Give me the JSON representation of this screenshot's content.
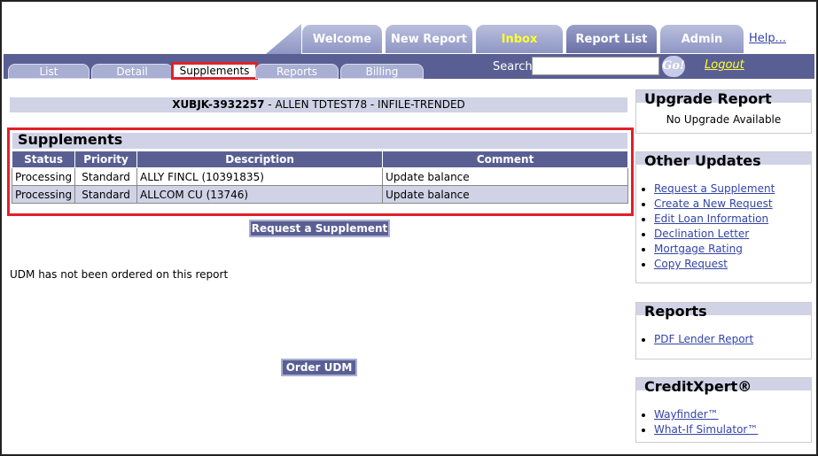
{
  "top_tabs": {
    "welcome": "Welcome",
    "new_report": "New Report",
    "inbox": "Inbox",
    "report_list": "Report List",
    "admin": "Admin",
    "help": "Help..."
  },
  "sub_tabs": {
    "list": "List",
    "detail": "Detail",
    "supplements": "Supplements",
    "reports": "Reports",
    "billing": "Billing"
  },
  "search": {
    "label": "Search:",
    "value": "",
    "go_label": "Go!"
  },
  "logout": "Logout",
  "report_header": {
    "id": "XUBJK-3932257",
    "rest": " - ALLEN TDTEST78 - INFILE-TRENDED"
  },
  "supplements": {
    "title": "Supplements",
    "columns": {
      "status": "Status",
      "priority": "Priority",
      "description": "Description",
      "comment": "Comment"
    },
    "rows": [
      {
        "status": "Processing",
        "priority": "Standard",
        "description": "ALLY FINCL (10391835)",
        "comment": "Update balance"
      },
      {
        "status": "Processing",
        "priority": "Standard",
        "description": "ALLCOM CU (13746)",
        "comment": "Update balance"
      }
    ],
    "request_button": "Request a Supplement"
  },
  "udm": {
    "message": "UDM has not been ordered on this report",
    "order_button": "Order UDM"
  },
  "sidebar": {
    "upgrade": {
      "title": "Upgrade Report",
      "text": "No Upgrade Available"
    },
    "other_updates": {
      "title": "Other Updates",
      "items": [
        "Request a Supplement",
        "Create a New Request",
        "Edit Loan Information",
        "Declination Letter",
        "Mortgage Rating",
        "Copy Request"
      ]
    },
    "reports": {
      "title": "Reports",
      "items": [
        "PDF Lender Report"
      ]
    },
    "creditxpert": {
      "title": "CreditXpert®",
      "items": [
        "Wayfinder™",
        "What-If Simulator™"
      ]
    }
  },
  "colors": {
    "nav_dark": "#5a5f93",
    "nav_light": "#a9aed3",
    "highlight": "#e0202a",
    "inbox": "#ffff33"
  }
}
